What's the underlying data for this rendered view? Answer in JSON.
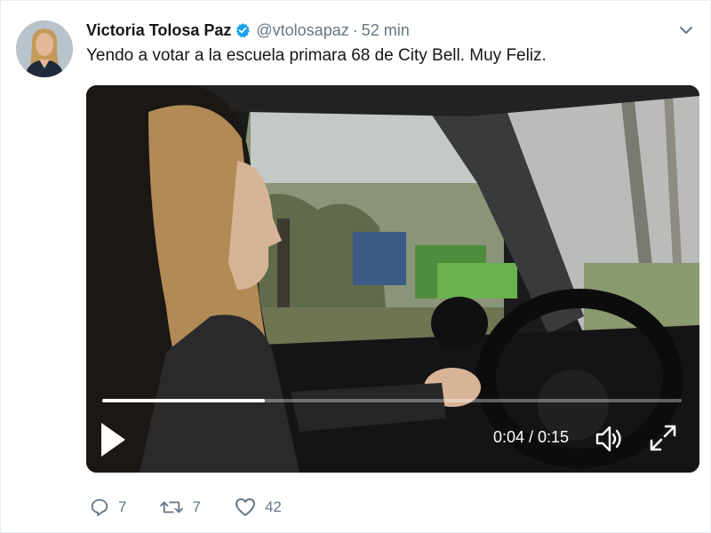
{
  "tweet": {
    "display_name": "Victoria Tolosa Paz",
    "handle": "@vtolosapaz",
    "separator": "·",
    "time": "52 min",
    "text": "Yendo a votar a la escuela primara 68 de City Bell. Muy Feliz.",
    "verified": true
  },
  "video": {
    "current_time": "0:04",
    "duration": "0:15",
    "time_label": "0:04 / 0:15",
    "progress_fraction": 0.28
  },
  "actions": {
    "reply_count": "7",
    "retweet_count": "7",
    "like_count": "42"
  },
  "icons": {
    "verified": "verified-badge-icon",
    "caret": "chevron-down-icon",
    "play": "play-icon",
    "volume": "volume-icon",
    "fullscreen": "fullscreen-icon",
    "reply": "reply-icon",
    "retweet": "retweet-icon",
    "like": "heart-icon"
  },
  "colors": {
    "accent": "#1da1f2",
    "muted": "#657786",
    "text": "#14171a"
  }
}
